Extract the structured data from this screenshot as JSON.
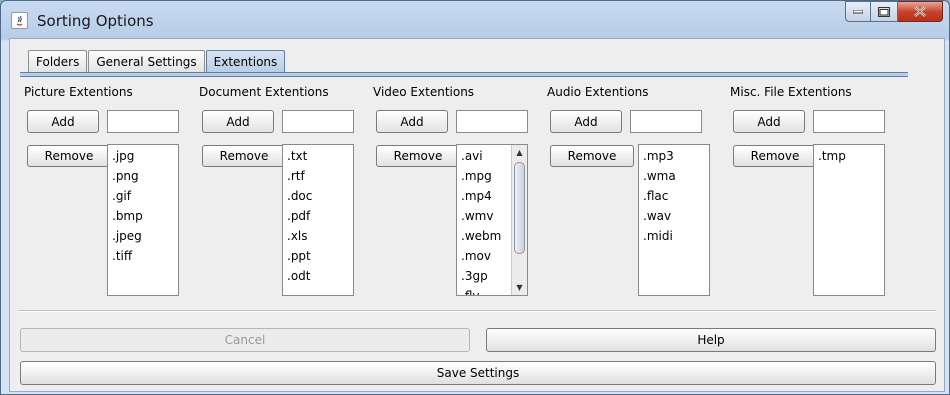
{
  "window": {
    "title": "Sorting Options"
  },
  "tabs": [
    {
      "label": "Folders",
      "active": false
    },
    {
      "label": "General Settings",
      "active": false
    },
    {
      "label": "Extentions",
      "active": true
    }
  ],
  "groups": [
    {
      "label": "Picture Extentions",
      "add_label": "Add",
      "remove_label": "Remove",
      "input_value": "",
      "items": [
        ".jpg",
        ".png",
        ".gif",
        ".bmp",
        ".jpeg",
        ".tiff"
      ]
    },
    {
      "label": "Document Extentions",
      "add_label": "Add",
      "remove_label": "Remove",
      "input_value": "",
      "items": [
        ".txt",
        ".rtf",
        ".doc",
        ".pdf",
        ".xls",
        ".ppt",
        ".odt"
      ]
    },
    {
      "label": "Video Extentions",
      "add_label": "Add",
      "remove_label": "Remove",
      "input_value": "",
      "items": [
        ".avi",
        ".mpg",
        ".mp4",
        ".wmv",
        ".webm",
        ".mov",
        ".3gp",
        ".flv"
      ],
      "scrollbar": true
    },
    {
      "label": "Audio Extentions",
      "add_label": "Add",
      "remove_label": "Remove",
      "input_value": "",
      "items": [
        ".mp3",
        ".wma",
        ".flac",
        ".wav",
        ".midi"
      ]
    },
    {
      "label": "Misc. File Extentions",
      "add_label": "Add",
      "remove_label": "Remove",
      "input_value": "",
      "items": [
        ".tmp"
      ]
    }
  ],
  "footer": {
    "cancel_label": "Cancel",
    "help_label": "Help",
    "save_label": "Save Settings"
  },
  "colors": {
    "accent": "#b9cde6",
    "close": "#c9452b"
  }
}
